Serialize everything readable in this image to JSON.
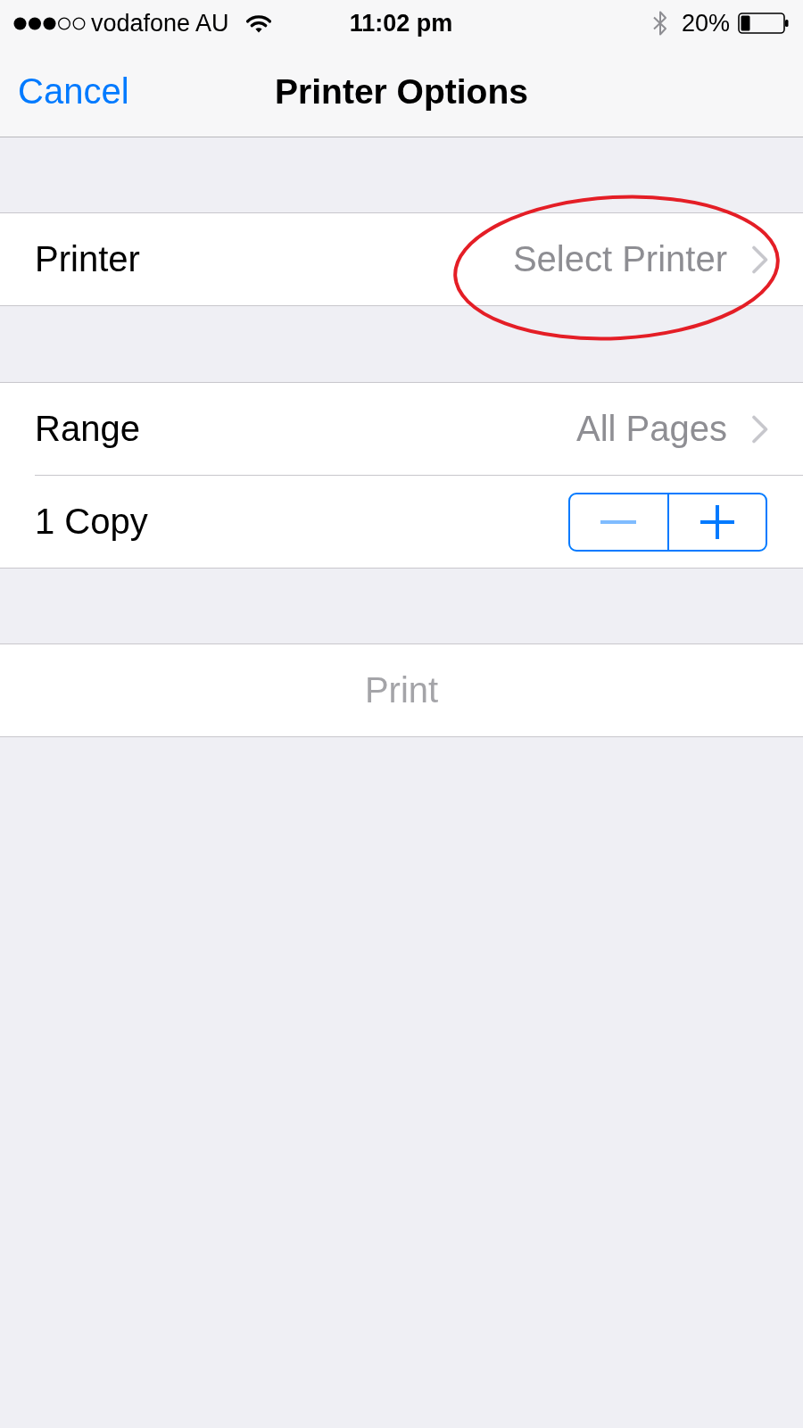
{
  "status_bar": {
    "carrier": "vodafone AU",
    "time": "11:02 pm",
    "battery": "20%"
  },
  "nav_bar": {
    "cancel": "Cancel",
    "title": "Printer Options"
  },
  "sections": [
    {
      "rows": [
        {
          "kind": "disclosure",
          "label": "Printer",
          "value": "Select Printer",
          "circled": true
        }
      ]
    },
    {
      "rows": [
        {
          "kind": "disclosure",
          "label": "Range",
          "value": "All Pages",
          "circled": false
        },
        {
          "kind": "stepper",
          "label": "1 Copy",
          "decrement": {
            "disabled": true
          },
          "increment": {
            "disabled": false
          }
        }
      ]
    },
    {
      "rows": [
        {
          "kind": "action",
          "label": "Print",
          "disabled": true
        }
      ]
    }
  ]
}
